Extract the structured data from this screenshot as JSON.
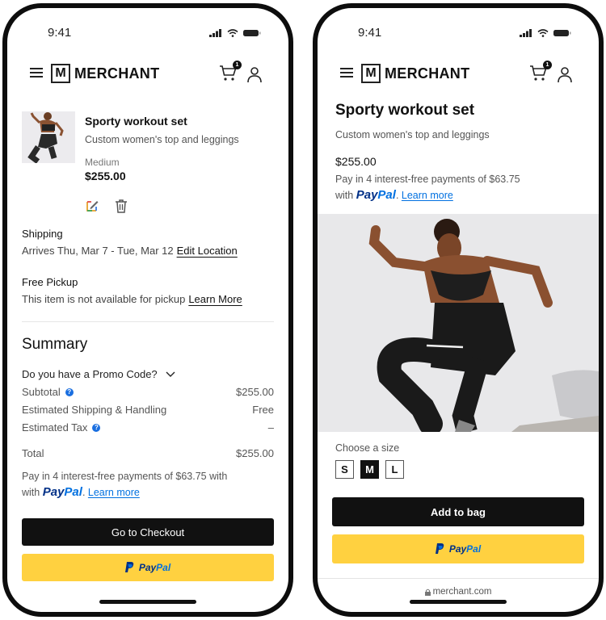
{
  "status_bar": {
    "time": "9:41"
  },
  "header": {
    "brand_initial": "M",
    "brand_name": "MERCHANT",
    "cart_count": "1"
  },
  "cart_screen": {
    "item": {
      "title": "Sporty workout set",
      "subtitle": "Custom women's top and leggings",
      "size": "Medium",
      "price": "$255.00"
    },
    "shipping": {
      "title": "Shipping",
      "text": "Arrives Thu, Mar 7 - Tue, Mar 12",
      "link": "Edit Location"
    },
    "pickup": {
      "title": "Free Pickup",
      "text": "This item is not available for pickup",
      "link": "Learn More"
    },
    "summary": {
      "title": "Summary",
      "promo": "Do you have a Promo Code?",
      "rows": [
        {
          "label": "Subtotal",
          "value": "$255.00"
        },
        {
          "label": "Estimated Shipping & Handling",
          "value": "Free"
        },
        {
          "label": "Estimated Tax",
          "value": "–"
        }
      ],
      "total_label": "Total",
      "total_value": "$255.00"
    },
    "paylater": {
      "text": "Pay in 4 interest-free payments of $63.75 with",
      "with": "with",
      "pay": "Pay",
      "pal": "Pal",
      "learn_more": "Learn more"
    },
    "checkout_button": "Go to Checkout",
    "paypal_button": {
      "pay": "Pay",
      "pal": "Pal"
    }
  },
  "product_screen": {
    "title": "Sporty workout set",
    "subtitle": "Custom women's top and leggings",
    "price": "$255.00",
    "paylater": {
      "text": "Pay in 4 interest-free payments of $63.75",
      "with": "with",
      "pay": "Pay",
      "pal": "Pal",
      "learn_more": "Learn more"
    },
    "size_label": "Choose a size",
    "sizes": [
      {
        "label": "S",
        "selected": false
      },
      {
        "label": "M",
        "selected": true
      },
      {
        "label": "L",
        "selected": false
      }
    ],
    "add_to_bag": "Add to bag",
    "paypal_button": {
      "pay": "Pay",
      "pal": "Pal"
    },
    "url": "merchant.com"
  },
  "colors": {
    "paypal_yellow": "#ffd140",
    "paypal_navy": "#003087",
    "paypal_blue": "#0070e0",
    "primary_black": "#111111"
  }
}
